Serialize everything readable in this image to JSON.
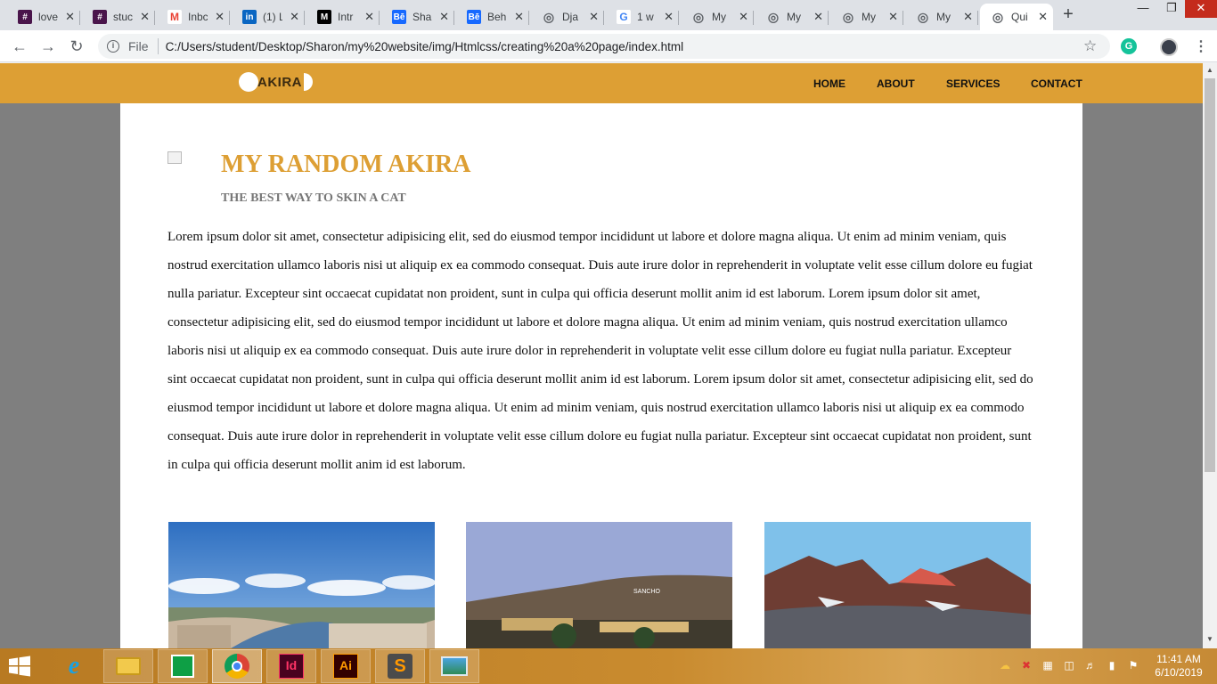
{
  "browser": {
    "tabs": [
      {
        "label": "love",
        "icon": "slack-icon",
        "color": "#4a154b"
      },
      {
        "label": "stuc",
        "icon": "slack-icon",
        "color": "#4a154b"
      },
      {
        "label": "Inbc",
        "icon": "gmail-icon",
        "color": "#ea4335"
      },
      {
        "label": "(1) L",
        "icon": "linkedin-icon",
        "color": "#0a66c2"
      },
      {
        "label": "Intr",
        "icon": "medium-icon",
        "color": "#000000"
      },
      {
        "label": "Sha",
        "icon": "behance-icon",
        "color": "#1769ff"
      },
      {
        "label": "Beh",
        "icon": "behance-icon",
        "color": "#1769ff"
      },
      {
        "label": "Dja",
        "icon": "globe-icon",
        "color": "#5f6368"
      },
      {
        "label": "1 w",
        "icon": "google-icon",
        "color": "#4285f4"
      },
      {
        "label": "My",
        "icon": "globe-icon",
        "color": "#5f6368"
      },
      {
        "label": "My",
        "icon": "globe-icon",
        "color": "#5f6368"
      },
      {
        "label": "My",
        "icon": "globe-icon",
        "color": "#5f6368"
      },
      {
        "label": "My",
        "icon": "globe-icon",
        "color": "#5f6368"
      },
      {
        "label": "Qui",
        "icon": "globe-icon",
        "color": "#5f6368",
        "active": true
      }
    ],
    "file_label": "File",
    "url": "C:/Users/student/Desktop/Sharon/my%20website/img/Htmlcss/creating%20a%20page/index.html"
  },
  "site": {
    "logo_text": "AKIRA",
    "nav": [
      "HOME",
      "ABOUT",
      "SERVICES",
      "CONTACT"
    ],
    "accent_color": "#dd9f34",
    "title": "MY RANDOM AKIRA",
    "subtitle": "THE BEST WAY TO SKIN A CAT",
    "body": "Lorem ipsum dolor sit amet, consectetur adipisicing elit, sed do eiusmod tempor incididunt ut labore et dolore magna aliqua. Ut enim ad minim veniam, quis nostrud exercitation ullamco laboris nisi ut aliquip ex ea commodo consequat. Duis aute irure dolor in reprehenderit in voluptate velit esse cillum dolore eu fugiat nulla pariatur. Excepteur sint occaecat cupidatat non proident, sunt in culpa qui officia deserunt mollit anim id est laborum. Lorem ipsum dolor sit amet, consectetur adipisicing elit, sed do eiusmod tempor incididunt ut labore et dolore magna aliqua. Ut enim ad minim veniam, quis nostrud exercitation ullamco laboris nisi ut aliquip ex ea commodo consequat. Duis aute irure dolor in reprehenderit in voluptate velit esse cillum dolore eu fugiat nulla pariatur. Excepteur sint occaecat cupidatat non proident, sunt in culpa qui officia deserunt mollit anim id est laborum. Lorem ipsum dolor sit amet, consectetur adipisicing elit, sed do eiusmod tempor incididunt ut labore et dolore magna aliqua. Ut enim ad minim veniam, quis nostrud exercitation ullamco laboris nisi ut aliquip ex ea commodo consequat. Duis aute irure dolor in reprehenderit in voluptate velit esse cillum dolore eu fugiat nulla pariatur. Excepteur sint occaecat cupidatat non proident, sunt in culpa qui officia deserunt mollit anim id est laborum.",
    "photo_sign_text": "SANCHO"
  },
  "taskbar": {
    "apps": [
      "internet-explorer-icon",
      "file-explorer-icon",
      "store-icon",
      "chrome-icon",
      "indesign-icon",
      "illustrator-icon",
      "sublime-text-icon",
      "photos-icon"
    ],
    "indesign_label": "Id",
    "illustrator_label": "Ai",
    "time": "11:41 AM",
    "date": "6/10/2019"
  }
}
